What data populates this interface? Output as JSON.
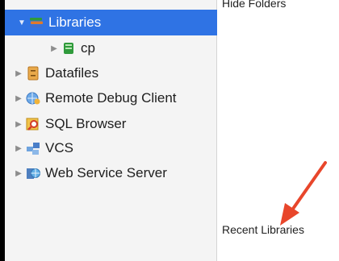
{
  "sidebar": {
    "items": [
      {
        "label": "Libraries",
        "icon": "books-icon",
        "expanded": true,
        "selected": true
      },
      {
        "label": "cp",
        "icon": "book-icon",
        "expanded": false
      },
      {
        "label": "Datafiles",
        "icon": "cabinet-icon",
        "expanded": false
      },
      {
        "label": "Remote Debug Client",
        "icon": "globe-icon",
        "expanded": false
      },
      {
        "label": "SQL Browser",
        "icon": "magnifier-icon",
        "expanded": false
      },
      {
        "label": "VCS",
        "icon": "network-icon",
        "expanded": false
      },
      {
        "label": "Web Service Server",
        "icon": "globe-server-icon",
        "expanded": false
      }
    ]
  },
  "content": {
    "hide_folders_label": "Hide Folders",
    "recent_libraries_label": "Recent Libraries"
  },
  "colors": {
    "selection": "#2f73e4",
    "arrow": "#e8462b"
  }
}
